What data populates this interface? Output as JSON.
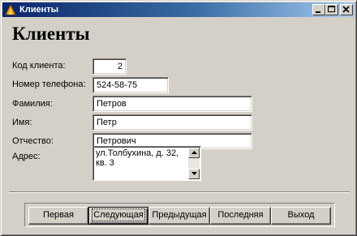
{
  "window": {
    "title": "Клиенты",
    "icon": "application-icon",
    "title_bar_color": "#0a246a",
    "face_color": "#d4d0c8"
  },
  "form": {
    "heading": "Клиенты",
    "fields": {
      "client_code": {
        "label": "Код клиента:",
        "value": "2"
      },
      "phone": {
        "label": "Номер телефона:",
        "value": "524-58-75"
      },
      "last_name": {
        "label": "Фамилия:",
        "value": "Петров"
      },
      "first_name": {
        "label": "Имя:",
        "value": "Петр"
      },
      "patronymic": {
        "label": "Отчество:",
        "value": "Петрович"
      },
      "address": {
        "label": "Адрес:",
        "value": "ул.Толбухина, д. 32, кв. 3"
      }
    }
  },
  "navigation": {
    "first_label": "Первая",
    "next_label": "Следующая",
    "previous_label": "Предыдущая",
    "last_label": "Последняя",
    "exit_label": "Выход",
    "focused": "Следующая"
  }
}
